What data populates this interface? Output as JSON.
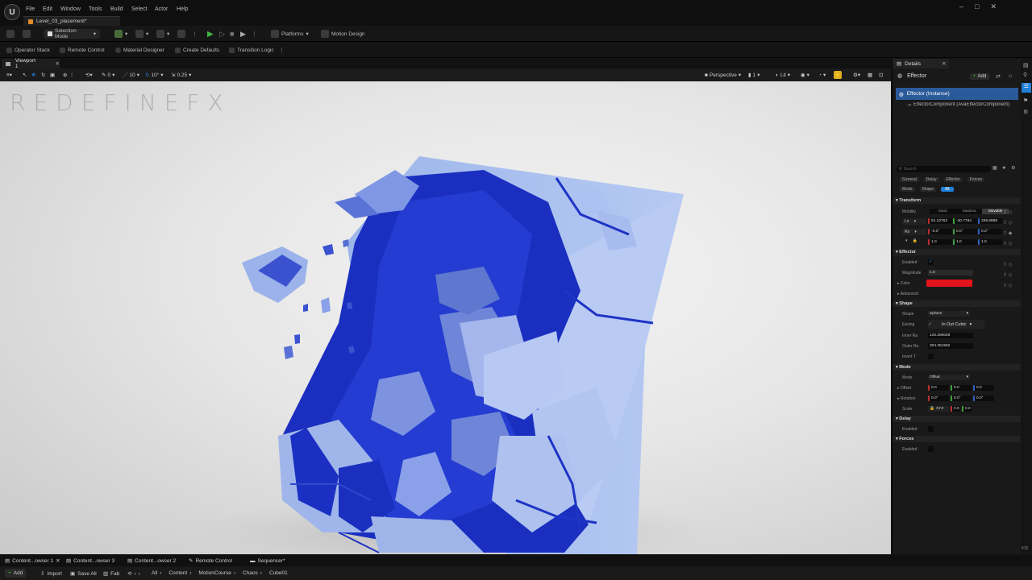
{
  "menu": {
    "items": [
      "File",
      "Edit",
      "Window",
      "Tools",
      "Build",
      "Select",
      "Actor",
      "Help"
    ],
    "level_tab": "Level_03_placement*"
  },
  "toolbar": {
    "selection_mode": "Selection Mode",
    "platforms": "Platforms",
    "motion_design": "Motion Design"
  },
  "toolbar2": {
    "items": [
      "Operator Stack",
      "Remote Control",
      "Material Designer",
      "Create Defaults",
      "Transition Logic"
    ]
  },
  "viewport": {
    "tab_label": "Viewport 1",
    "snap_rotation": "0",
    "grid_size": "10",
    "angle_snap": "10°",
    "scale_snap": "0.25",
    "perspective": "Perspective",
    "camera_speed": "1",
    "lit": "Lit",
    "watermark": "REDEFINEFX"
  },
  "details": {
    "tab_label": "Details",
    "actor_name": "Effector",
    "add_button": "Add",
    "instance": "Effector (Instance)",
    "component": "EffectorComponent (AvaEffectorComponent)",
    "search_placeholder": "Search",
    "filters_row1": [
      "General",
      "Delay",
      "Effector",
      "Forces"
    ],
    "filters_row2": [
      "Mode",
      "Shape",
      "All"
    ],
    "transform": {
      "section": "Transform",
      "mobility_label": "Mobility",
      "mobility_options": [
        "Static",
        "Stationa",
        "Movable"
      ],
      "location_label": "Lo",
      "location": [
        "61.10762",
        "-30.7784",
        "339.9889"
      ],
      "rotation_label": "Ro",
      "rotation": [
        "-0.0°",
        "0.0°",
        "0.0°"
      ],
      "scale": [
        "1.0",
        "1.0",
        "1.0"
      ]
    },
    "effector": {
      "section": "Effector",
      "enabled_label": "Enabled",
      "magnitude_label": "Magnitude",
      "magnitude": "1.0",
      "color_label": "Color",
      "color": "#e0141a",
      "advanced_label": "Advanced"
    },
    "shape": {
      "section": "Shape",
      "shape_label": "Shape",
      "shape_value": "Sphere",
      "easing_label": "Easing",
      "easing_value": "In Out Cubic",
      "inner_label": "Inner Ra",
      "inner_value": "125.256028",
      "outer_label": "Outer Ra",
      "outer_value": "304.351562",
      "invert_label": "Invert T"
    },
    "mode": {
      "section": "Mode",
      "mode_label": "Mode",
      "mode_value": "Offset",
      "offset_label": "Offset",
      "offset": [
        "0.0",
        "0.0",
        "0.0"
      ],
      "rotation_label": "Rotation",
      "rotation": [
        "0.0°",
        "0.0°",
        "0.0°"
      ],
      "scale_label": "Scale",
      "scale_lock": "XYZ",
      "scale": [
        "0.0",
        "0.0"
      ]
    },
    "delay": {
      "section": "Delay",
      "enabled_label": "Enabled"
    },
    "forces": {
      "section": "Forces",
      "enabled_label": "Enabled"
    }
  },
  "bottom_tabs": [
    "Content...owser 1",
    "Content...owser 3",
    "Content...owser 2",
    "Remote Control",
    "Sequencer*"
  ],
  "bottom_bar": {
    "add": "Add",
    "import": "Import",
    "save_all": "Save All",
    "fab": "Fab",
    "path": [
      "All",
      "Content",
      "MotionCourse",
      "Chaos",
      "Cube01"
    ]
  },
  "corner_text": "415",
  "colors": {
    "accent": "#1f7fd6",
    "play_green": "#3fb43f",
    "selection_blue": "#2a5a9a"
  }
}
